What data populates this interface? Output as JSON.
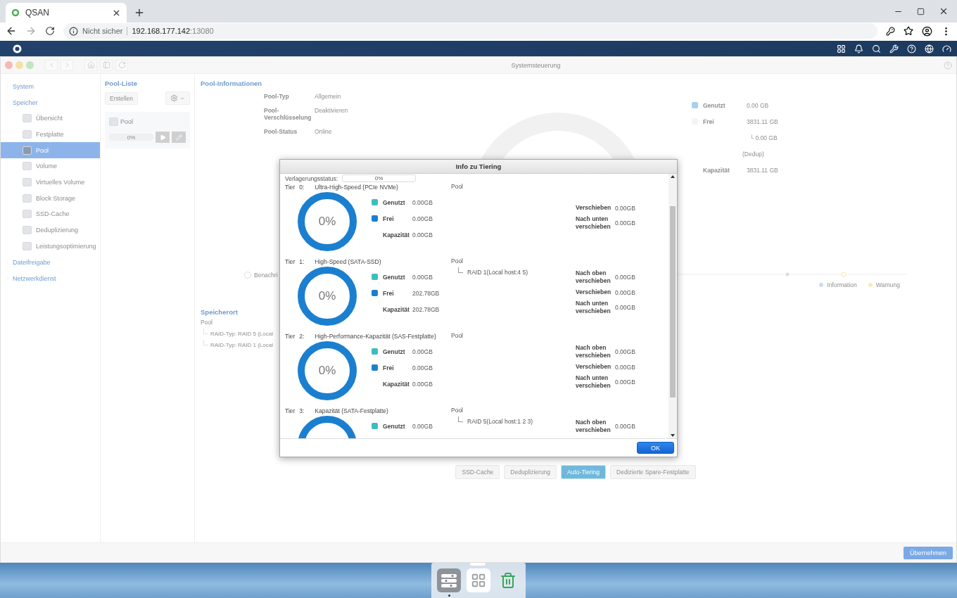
{
  "browser": {
    "tab_title": "QSAN",
    "security": "Nicht sicher",
    "url_host": "192.168.177.142",
    "url_port": ":13080"
  },
  "window": {
    "title": "Systemsteuerung"
  },
  "sidebar": {
    "items": [
      {
        "label": "System",
        "expanded": false
      },
      {
        "label": "Speicher",
        "expanded": true,
        "children": [
          {
            "label": "Übersicht",
            "selected": false
          },
          {
            "label": "Festplatte",
            "selected": false
          },
          {
            "label": "Pool",
            "selected": true
          },
          {
            "label": "Volume",
            "selected": false
          },
          {
            "label": "Virtuelles Volume",
            "selected": false
          },
          {
            "label": "Block Storage",
            "selected": false
          },
          {
            "label": "SSD-Cache",
            "selected": false
          },
          {
            "label": "Deduplizierung",
            "selected": false
          },
          {
            "label": "Leistungsoptimierung",
            "selected": false
          }
        ]
      },
      {
        "label": "Dateifreigabe",
        "expanded": false
      },
      {
        "label": "Netzwerkdienst",
        "expanded": false
      }
    ]
  },
  "pool_list": {
    "title": "Pool-Liste",
    "create_button": "Erstellen",
    "pools": [
      {
        "name": "Pool",
        "progress": "0%",
        "level": 0
      }
    ]
  },
  "pool_info": {
    "title": "Pool-Informationen",
    "fields": [
      {
        "label": "Pool-Typ",
        "value": "Allgemein"
      },
      {
        "label": "Pool-Verschlüsselung",
        "value": "Deaktivieren"
      },
      {
        "label": "Pool-Status",
        "value": "Online"
      }
    ],
    "legend": [
      {
        "label": "Genutzt",
        "value": "0.00 GB",
        "color": "#a9d0ec"
      },
      {
        "label": "Frei",
        "value": "3831.11 GB",
        "color": "#f2f4f6",
        "notes": [
          "└ 0.00 GB",
          "(Dedup)"
        ]
      },
      {
        "label": "Kapazität",
        "value": "3831.11 GB"
      }
    ]
  },
  "notification": {
    "label": "Benachri",
    "checked": false
  },
  "event_legend": [
    {
      "label": "Information",
      "color": "#c9dcf0"
    },
    {
      "label": "Warnung",
      "color": "#f5edb8"
    }
  ],
  "location": {
    "title": "Speicherort",
    "root": "Pool",
    "children": [
      "RAID-Typ: RAID 5 (Local",
      "RAID-Typ: RAID 1 (Local"
    ]
  },
  "feature_tabs": [
    {
      "label": "SSD-Cache",
      "selected": false
    },
    {
      "label": "Deduplizierung",
      "selected": false
    },
    {
      "label": "Auto-Tiering",
      "selected": true
    },
    {
      "label": "Dedizierte Spare-Festplatte",
      "selected": false
    }
  ],
  "apply_button": "Übernehmen",
  "dialog": {
    "title": "Info zu Tiering",
    "status_label": "Verlagerungsstatus:",
    "status_value": "0%",
    "ok_button": "OK",
    "tiers": [
      {
        "prefix": "Tier",
        "index": "0:",
        "name": "Ultra-High-Speed (PCIe NVMe)",
        "percent": "0%",
        "usage": [
          {
            "label": "Genutzt",
            "value": "0.00GB",
            "color": "#3dbdbf"
          },
          {
            "label": "Frei",
            "value": "0.00GB",
            "color": "#1b7fd0"
          },
          {
            "label": "Kapazität",
            "value": "0.00GB"
          }
        ],
        "pool": "Pool",
        "moves": [
          {
            "label": "Verschieben",
            "value": "0.00GB"
          },
          {
            "label": "Nach unten verschieben",
            "value": "0.00GB"
          }
        ]
      },
      {
        "prefix": "Tier",
        "index": "1:",
        "name": "High-Speed (SATA-SSD)",
        "percent": "0%",
        "usage": [
          {
            "label": "Genutzt",
            "value": "0.00GB",
            "color": "#3dbdbf"
          },
          {
            "label": "Frei",
            "value": "202.78GB",
            "color": "#1b7fd0"
          },
          {
            "label": "Kapazität",
            "value": "202.78GB"
          }
        ],
        "pool": "Pool",
        "raids": [
          "RAID 1(Local host:4 5)"
        ],
        "moves": [
          {
            "label": "Nach oben verschieben",
            "value": "0.00GB"
          },
          {
            "label": "Verschieben",
            "value": "0.00GB"
          },
          {
            "label": "Nach unten verschieben",
            "value": "0.00GB"
          }
        ]
      },
      {
        "prefix": "Tier",
        "index": "2:",
        "name": "High-Performance-Kapazität (SAS-Festplatte)",
        "percent": "0%",
        "usage": [
          {
            "label": "Genutzt",
            "value": "0.00GB",
            "color": "#3dbdbf"
          },
          {
            "label": "Frei",
            "value": "0.00GB",
            "color": "#1b7fd0"
          },
          {
            "label": "Kapazität",
            "value": "0.00GB"
          }
        ],
        "pool": "Pool",
        "moves": [
          {
            "label": "Nach oben verschieben",
            "value": "0.00GB"
          },
          {
            "label": "Verschieben",
            "value": "0.00GB"
          },
          {
            "label": "Nach unten verschieben",
            "value": "0.00GB"
          }
        ]
      },
      {
        "prefix": "Tier",
        "index": "3:",
        "name": "Kapazität (SATA-Festplatte)",
        "usage": [
          {
            "label": "Genutzt",
            "value": "0.00GB",
            "color": "#3dbdbf"
          }
        ],
        "pool": "Pool",
        "raids": [
          "RAID 5(Local host:1 2 3)"
        ],
        "moves": [
          {
            "label": "Nach oben verschieben",
            "value": "0.00GB"
          }
        ]
      }
    ]
  }
}
